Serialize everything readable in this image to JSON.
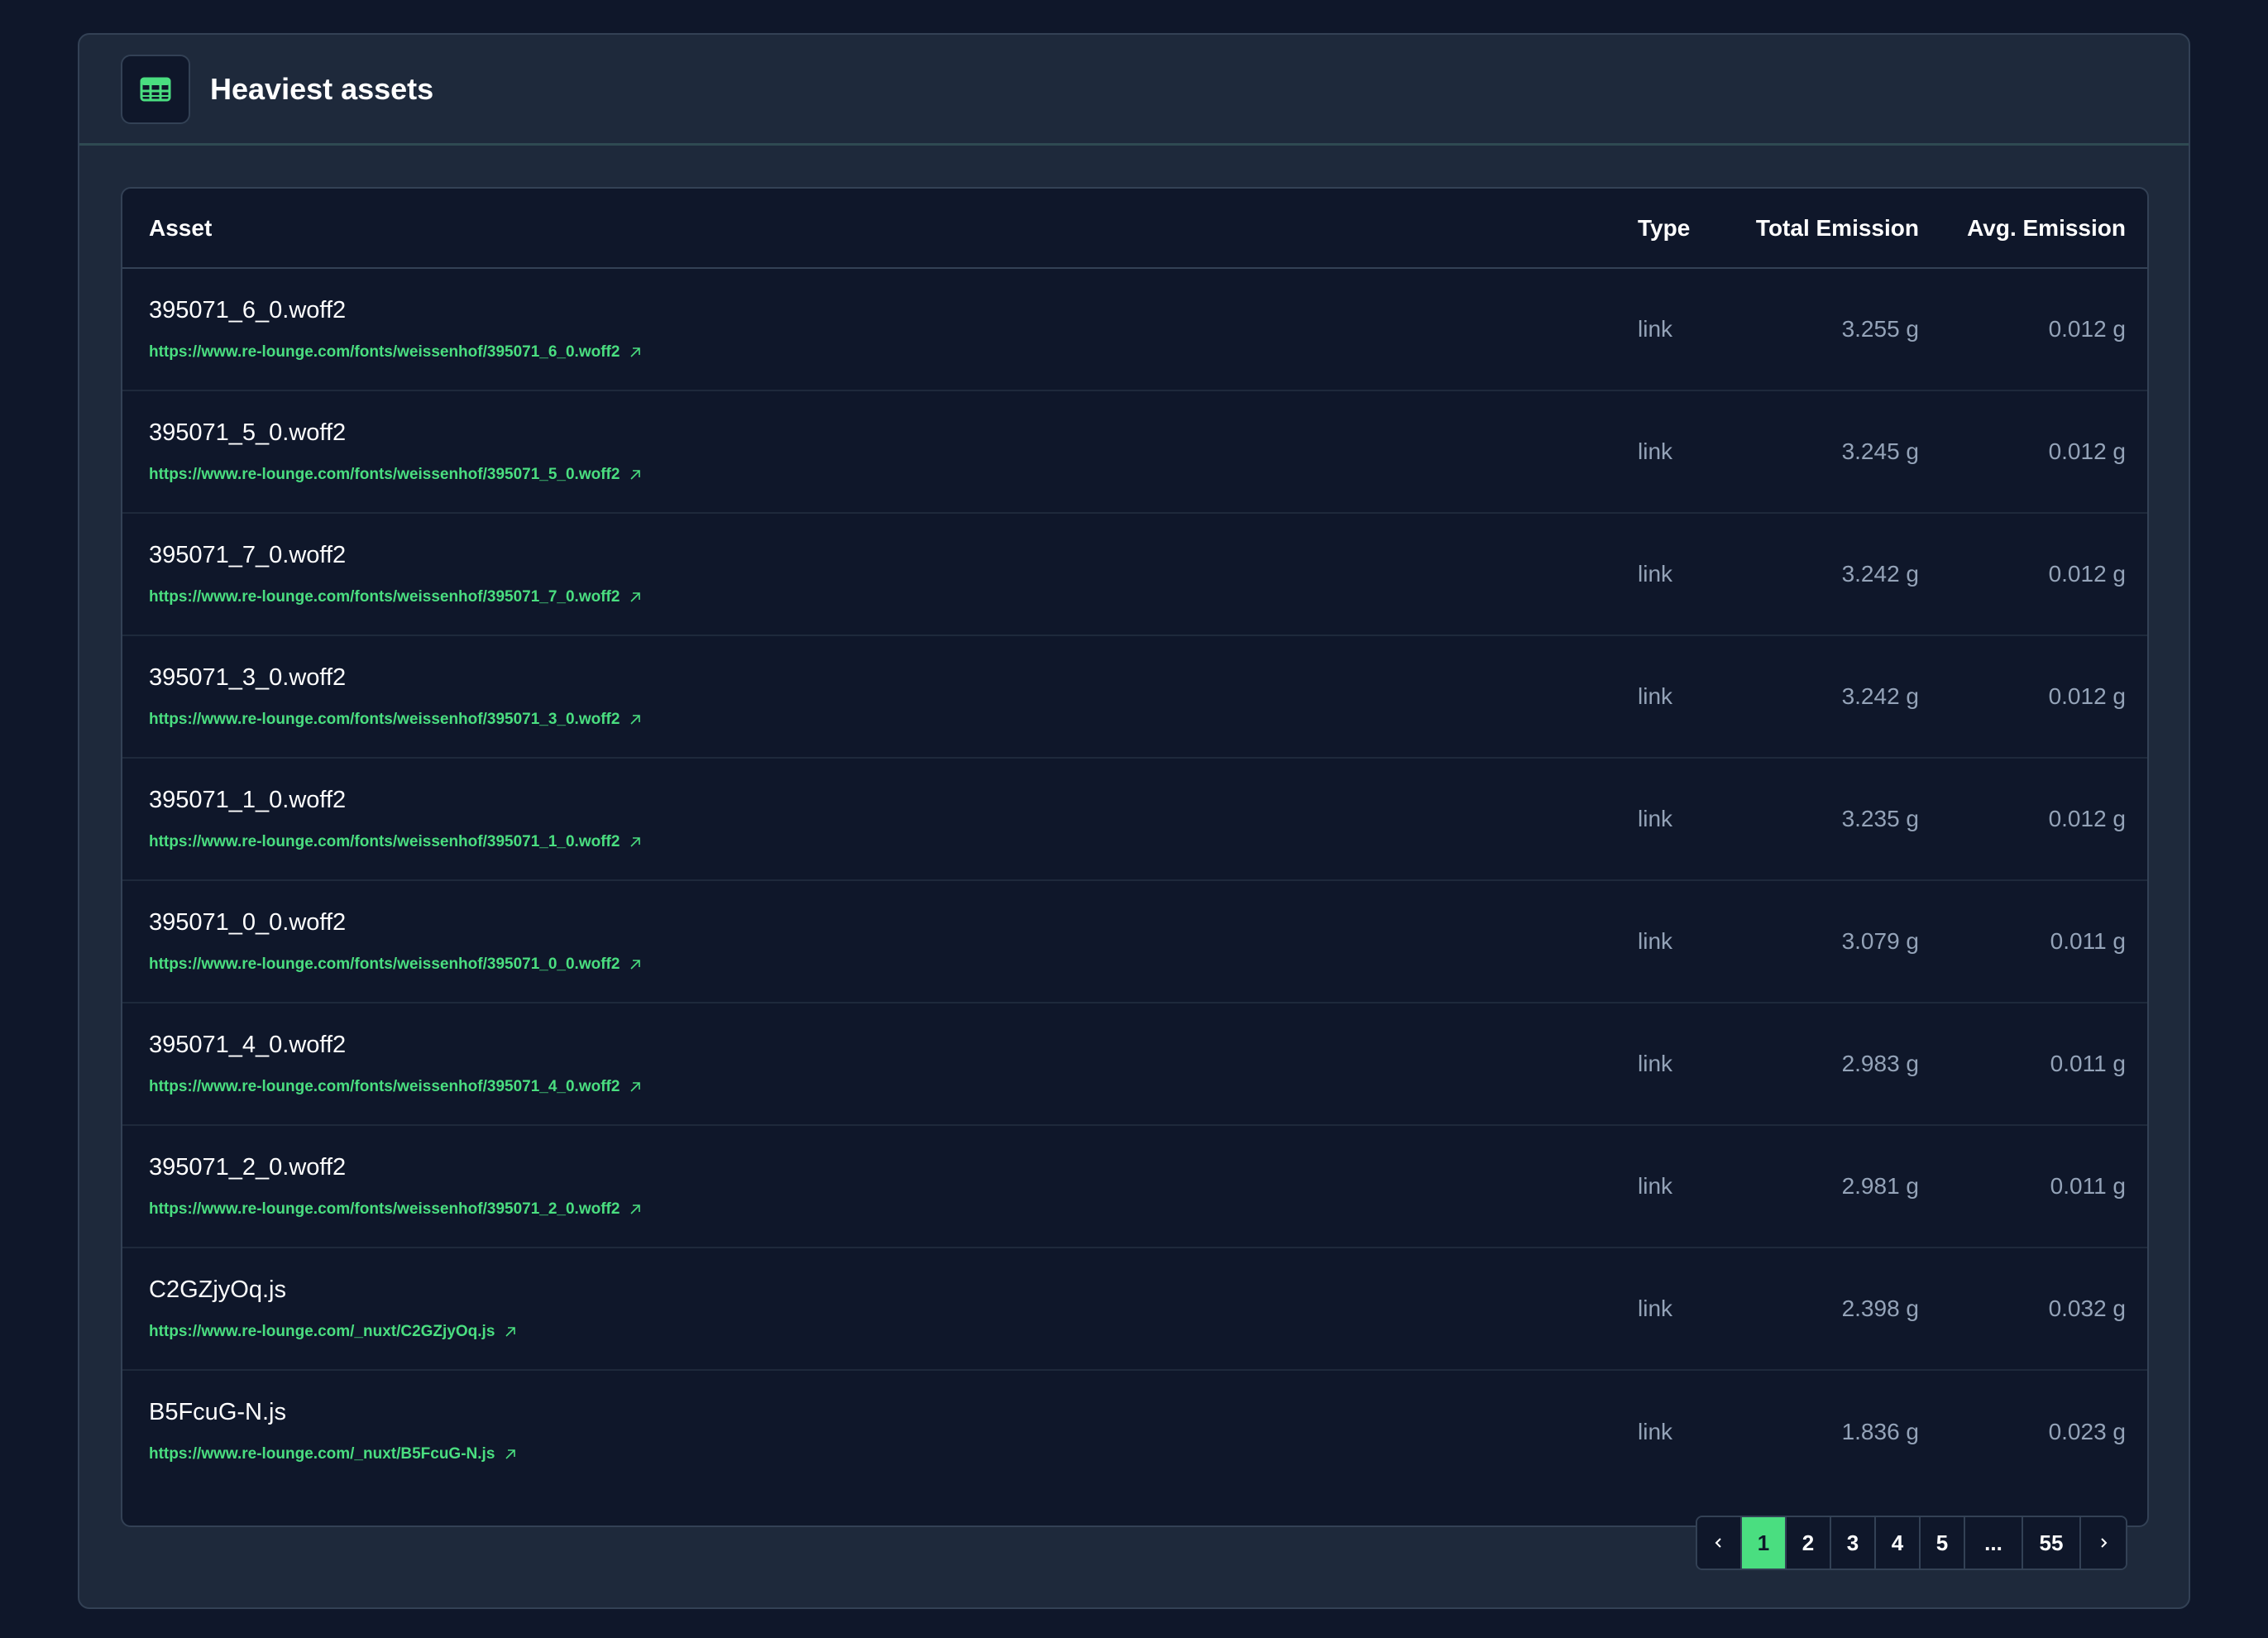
{
  "header": {
    "title": "Heaviest assets",
    "icon": "table-icon"
  },
  "colors": {
    "accent": "#4ade80",
    "background": "#0f172a",
    "card": "#1e293b"
  },
  "table": {
    "columns": [
      "Asset",
      "Type",
      "Total Emission",
      "Avg. Emission"
    ],
    "rows": [
      {
        "name": "395071_6_0.woff2",
        "url": "https://www.re-lounge.com/fonts/weissenhof/395071_6_0.woff2",
        "type": "link",
        "total": "3.255 g",
        "avg": "0.012 g"
      },
      {
        "name": "395071_5_0.woff2",
        "url": "https://www.re-lounge.com/fonts/weissenhof/395071_5_0.woff2",
        "type": "link",
        "total": "3.245 g",
        "avg": "0.012 g"
      },
      {
        "name": "395071_7_0.woff2",
        "url": "https://www.re-lounge.com/fonts/weissenhof/395071_7_0.woff2",
        "type": "link",
        "total": "3.242 g",
        "avg": "0.012 g"
      },
      {
        "name": "395071_3_0.woff2",
        "url": "https://www.re-lounge.com/fonts/weissenhof/395071_3_0.woff2",
        "type": "link",
        "total": "3.242 g",
        "avg": "0.012 g"
      },
      {
        "name": "395071_1_0.woff2",
        "url": "https://www.re-lounge.com/fonts/weissenhof/395071_1_0.woff2",
        "type": "link",
        "total": "3.235 g",
        "avg": "0.012 g"
      },
      {
        "name": "395071_0_0.woff2",
        "url": "https://www.re-lounge.com/fonts/weissenhof/395071_0_0.woff2",
        "type": "link",
        "total": "3.079 g",
        "avg": "0.011 g"
      },
      {
        "name": "395071_4_0.woff2",
        "url": "https://www.re-lounge.com/fonts/weissenhof/395071_4_0.woff2",
        "type": "link",
        "total": "2.983 g",
        "avg": "0.011 g"
      },
      {
        "name": "395071_2_0.woff2",
        "url": "https://www.re-lounge.com/fonts/weissenhof/395071_2_0.woff2",
        "type": "link",
        "total": "2.981 g",
        "avg": "0.011 g"
      },
      {
        "name": "C2GZjyOq.js",
        "url": "https://www.re-lounge.com/_nuxt/C2GZjyOq.js",
        "type": "link",
        "total": "2.398 g",
        "avg": "0.032 g"
      },
      {
        "name": "B5FcuG-N.js",
        "url": "https://www.re-lounge.com/_nuxt/B5FcuG-N.js",
        "type": "link",
        "total": "1.836 g",
        "avg": "0.023 g"
      }
    ]
  },
  "pagination": {
    "prev_icon": "chevron-left-icon",
    "next_icon": "chevron-right-icon",
    "pages": [
      "1",
      "2",
      "3",
      "4",
      "5",
      "...",
      "55"
    ],
    "current": "1"
  }
}
